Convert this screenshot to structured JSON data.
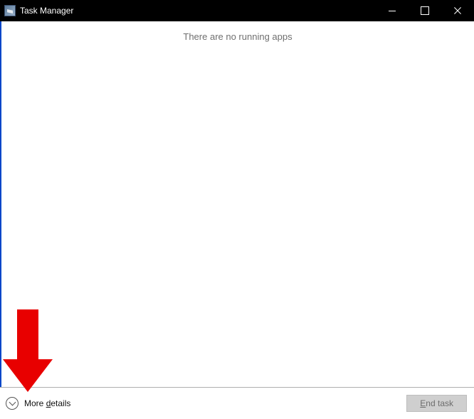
{
  "titlebar": {
    "title": "Task Manager"
  },
  "content": {
    "empty_message": "There are no running apps"
  },
  "footer": {
    "more_details_prefix": "More ",
    "more_details_ul": "d",
    "more_details_suffix": "etails",
    "end_task_ul": "E",
    "end_task_suffix": "nd task"
  },
  "annotation": {
    "arrow_color": "#e80000"
  }
}
